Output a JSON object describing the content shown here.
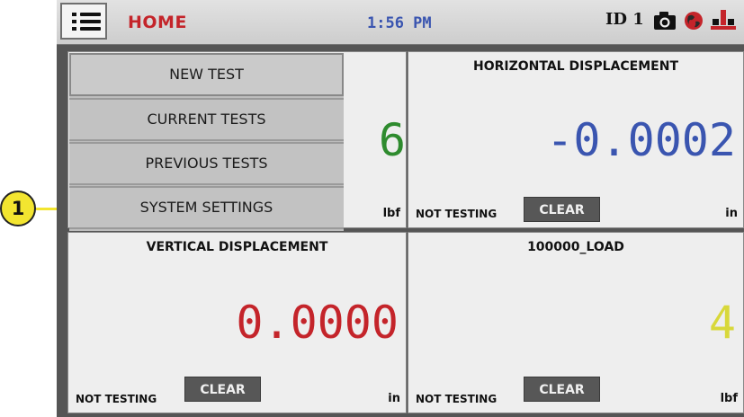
{
  "header": {
    "home_label": "HOME",
    "time": "1:56 PM",
    "id_label": "ID 1",
    "icons": [
      "menu-icon",
      "camera-icon",
      "globe-icon",
      "crane-icon"
    ]
  },
  "menu": {
    "items": [
      {
        "label": "NEW TEST"
      },
      {
        "label": "CURRENT TESTS"
      },
      {
        "label": "PREVIOUS TESTS"
      },
      {
        "label": "SYSTEM SETTINGS"
      }
    ]
  },
  "panels": {
    "load": {
      "value_partial": "6",
      "unit": "lbf",
      "color": "#2e8b2e"
    },
    "horizontal": {
      "title": "HORIZONTAL DISPLACEMENT",
      "value": "-0.0002",
      "status": "NOT TESTING",
      "clear_label": "CLEAR",
      "unit": "in",
      "color": "#3a55b0"
    },
    "vertical": {
      "title": "VERTICAL DISPLACEMENT",
      "value": "0.0000",
      "status": "NOT TESTING",
      "clear_label": "CLEAR",
      "unit": "in",
      "color": "#c4242a"
    },
    "load100k": {
      "title": "100000_LOAD",
      "value": "4",
      "status": "NOT TESTING",
      "clear_label": "CLEAR",
      "unit": "lbf",
      "color": "#d8d83a"
    }
  },
  "callout": {
    "number": "1",
    "color": "#f3e530"
  }
}
